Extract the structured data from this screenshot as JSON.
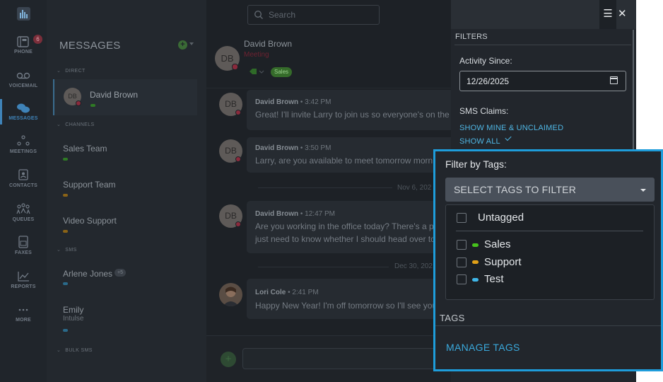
{
  "colors": {
    "accent": "#1e9ddb",
    "link": "#4fb6e4",
    "sales": "#46c21c",
    "support": "#e0a018",
    "test": "#3fb6e8",
    "busy": "#8a2a3c"
  },
  "nav": {
    "items": [
      {
        "label": "PHONE",
        "icon": "phone-icon",
        "badge": "6"
      },
      {
        "label": "VOICEMAIL",
        "icon": "voicemail-icon"
      },
      {
        "label": "MESSAGES",
        "icon": "chat-bubbles-icon"
      },
      {
        "label": "MEETINGS",
        "icon": "meetings-icon"
      },
      {
        "label": "CONTACTS",
        "icon": "contacts-icon"
      },
      {
        "label": "QUEUES",
        "icon": "queues-icon"
      },
      {
        "label": "FAXES",
        "icon": "fax-icon"
      },
      {
        "label": "REPORTS",
        "icon": "reports-icon"
      },
      {
        "label": "MORE",
        "icon": "more-dots-icon"
      }
    ]
  },
  "search": {
    "placeholder": "Search"
  },
  "list": {
    "title": "MESSAGES",
    "sections": {
      "direct": "DIRECT",
      "channels": "CHANNELS",
      "sms": "SMS",
      "bulk": "BULK SMS"
    },
    "direct": [
      {
        "name": "David Brown",
        "initials": "DB"
      }
    ],
    "channels": [
      {
        "name": "Sales Team"
      },
      {
        "name": "Support Team"
      },
      {
        "name": "Video Support"
      }
    ],
    "sms": [
      {
        "name": "Arlene Jones",
        "extra": "+5"
      },
      {
        "name": "Emily",
        "sub": "Intulse"
      }
    ]
  },
  "chat": {
    "contact_name": "David Brown",
    "contact_initials": "DB",
    "contact_status": "Meeting",
    "contact_tag": "Sales",
    "messages": [
      {
        "initials": "DB",
        "from": "David Brown",
        "time": " • 3:42 PM",
        "lines": [
          "Great! I'll invite Larry to join us so everyone's on the s"
        ]
      },
      {
        "initials": "DB",
        "from": "David Brown",
        "time": " • 3:50 PM",
        "lines": [
          "Larry, are you available to meet tomorrow morni"
        ]
      },
      {
        "initials": "DB",
        "from": "David Brown",
        "time": " • 12:47 PM",
        "lines": [
          "Are you working in the office today? There's a pa",
          "just need to know whether I should head over to"
        ]
      },
      {
        "initials": "",
        "from": "Lori Cole",
        "time": " • 2:41 PM",
        "lines": [
          "Happy New Year! I'm off tomorrow so I'll see you"
        ]
      }
    ],
    "dates": [
      "Nov 6, 202",
      "Dec 30, 202"
    ]
  },
  "filters": {
    "header": "FILTERS",
    "activity_label": "Activity Since:",
    "activity_value": "12/26/2025",
    "sms_claims_label": "SMS Claims:",
    "show_mine": "SHOW MINE & UNCLAIMED",
    "show_all": "SHOW ALL",
    "tags_filter_label": "Filter by Tags:",
    "select_placeholder": "SELECT TAGS TO FILTER",
    "options": [
      {
        "label": "Untagged",
        "checked": false
      },
      {
        "label": "Sales",
        "checked": false,
        "color": "#46c21c"
      },
      {
        "label": "Support",
        "checked": false,
        "color": "#e0a018"
      },
      {
        "label": "Test",
        "checked": false,
        "color": "#3fb6e8"
      }
    ],
    "tags_header": "TAGS",
    "manage_tags": "MANAGE TAGS"
  }
}
